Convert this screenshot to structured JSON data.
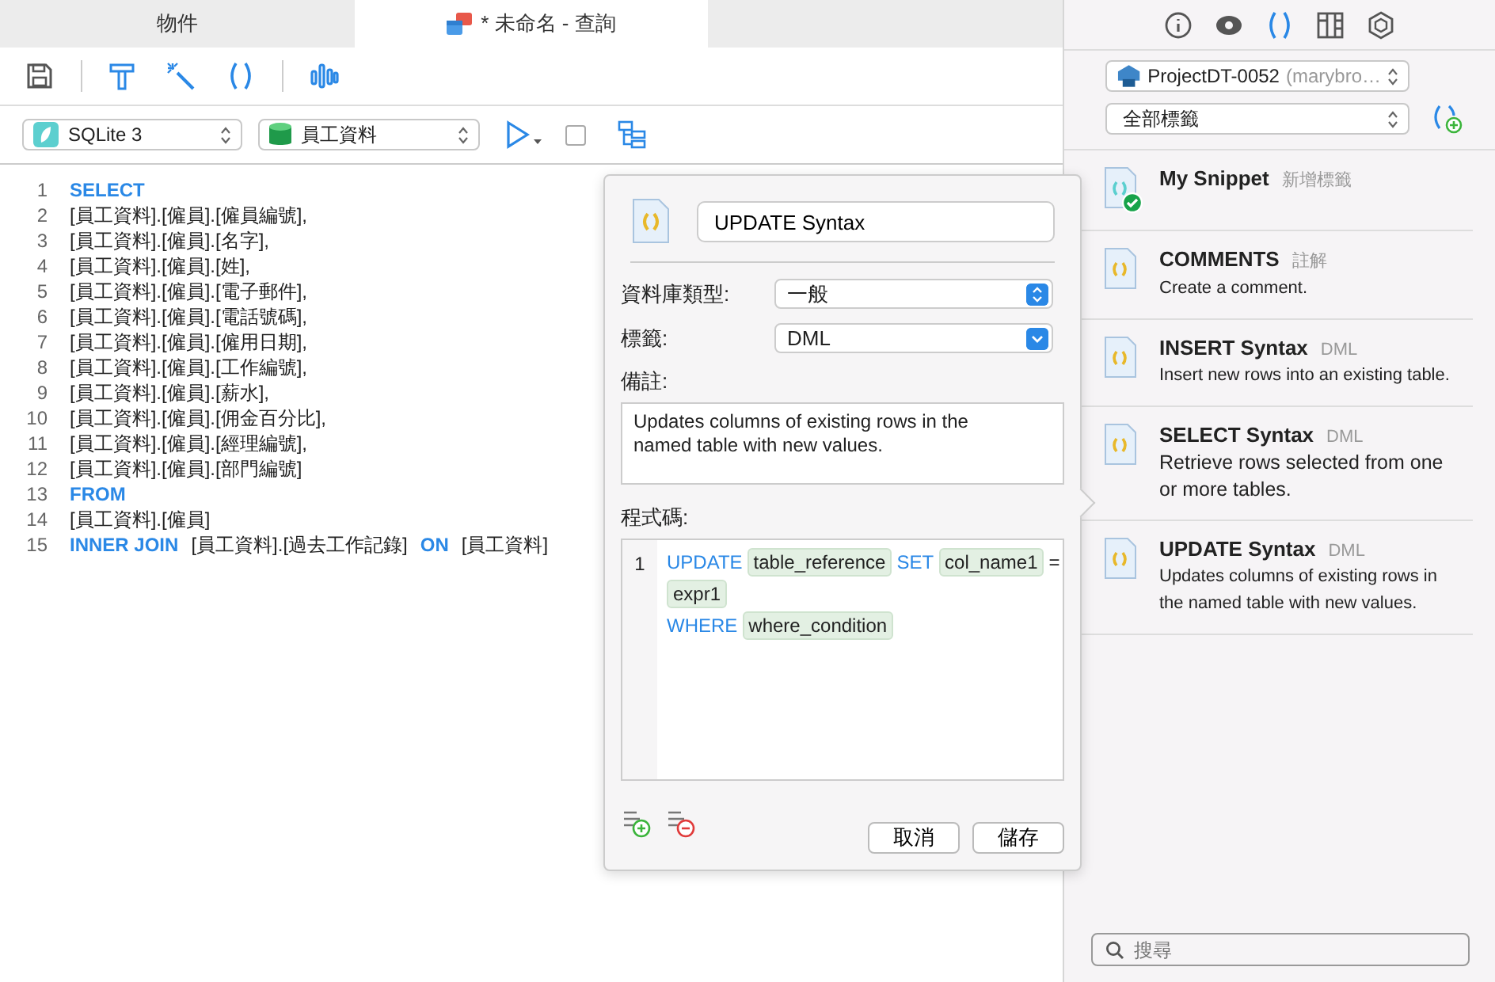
{
  "tabs": [
    {
      "label": "物件",
      "selected": false,
      "kind": "plain"
    },
    {
      "label": "* 未命名 - 查詢",
      "selected": true,
      "kind": "query"
    }
  ],
  "connection": {
    "type": "SQLite 3",
    "database": "員工資料"
  },
  "editor": {
    "lines": [
      {
        "number": "1",
        "tokens": [
          {
            "kind": "keyword",
            "text": "SELECT"
          }
        ]
      },
      {
        "number": "2",
        "tokens": [
          {
            "kind": "text",
            "text": "[員工資料].[僱員].[僱員編號],"
          }
        ]
      },
      {
        "number": "3",
        "tokens": [
          {
            "kind": "text",
            "text": "[員工資料].[僱員].[名字],"
          }
        ]
      },
      {
        "number": "4",
        "tokens": [
          {
            "kind": "text",
            "text": "[員工資料].[僱員].[姓],"
          }
        ]
      },
      {
        "number": "5",
        "tokens": [
          {
            "kind": "text",
            "text": "[員工資料].[僱員].[電子郵件],"
          }
        ]
      },
      {
        "number": "6",
        "tokens": [
          {
            "kind": "text",
            "text": "[員工資料].[僱員].[電話號碼],"
          }
        ]
      },
      {
        "number": "7",
        "tokens": [
          {
            "kind": "text",
            "text": "[員工資料].[僱員].[僱用日期],"
          }
        ]
      },
      {
        "number": "8",
        "tokens": [
          {
            "kind": "text",
            "text": "[員工資料].[僱員].[工作編號],"
          }
        ]
      },
      {
        "number": "9",
        "tokens": [
          {
            "kind": "text",
            "text": "[員工資料].[僱員].[薪水],"
          }
        ]
      },
      {
        "number": "10",
        "tokens": [
          {
            "kind": "text",
            "text": "[員工資料].[僱員].[佣金百分比],"
          }
        ]
      },
      {
        "number": "11",
        "tokens": [
          {
            "kind": "text",
            "text": "[員工資料].[僱員].[經理編號],"
          }
        ]
      },
      {
        "number": "12",
        "tokens": [
          {
            "kind": "text",
            "text": "[員工資料].[僱員].[部門編號]"
          }
        ]
      },
      {
        "number": "13",
        "tokens": [
          {
            "kind": "keyword",
            "text": "FROM"
          }
        ]
      },
      {
        "number": "14",
        "tokens": [
          {
            "kind": "text",
            "text": "[員工資料].[僱員]"
          }
        ]
      },
      {
        "number": "15",
        "tokens": [
          {
            "kind": "keyword",
            "text": "INNER JOIN"
          },
          {
            "kind": "text",
            "text": "[員工資料].[過去工作記錄]"
          },
          {
            "kind": "keyword",
            "text": "ON"
          },
          {
            "kind": "text",
            "text": "[員工資料]"
          }
        ]
      }
    ]
  },
  "popover": {
    "name": "UPDATE Syntax",
    "db_type": {
      "label": "資料庫類型:",
      "value": "一般"
    },
    "tag": {
      "label": "標籤:",
      "value": "DML"
    },
    "note": {
      "label": "備註:",
      "value": "Updates columns of existing rows in the named table with new values."
    },
    "code": {
      "label": "程式碼:",
      "number": "1",
      "rows": [
        [
          {
            "kind": "keyword",
            "text": "UPDATE"
          },
          {
            "kind": "placeholder",
            "text": "table_reference"
          },
          {
            "kind": "keyword",
            "text": "SET"
          },
          {
            "kind": "placeholder",
            "text": "col_name1"
          },
          {
            "kind": "text",
            "text": "="
          },
          {
            "kind": "placeholder",
            "text": "expr1"
          }
        ],
        [
          {
            "kind": "keyword",
            "text": "WHERE"
          },
          {
            "kind": "placeholder",
            "text": "where_condition"
          }
        ]
      ]
    },
    "buttons": [
      "取消",
      "儲存"
    ]
  },
  "side_tabs": [
    {
      "kind": "info",
      "selected": false
    },
    {
      "kind": "preview",
      "selected": false
    },
    {
      "kind": "snippet",
      "selected": true
    },
    {
      "kind": "columns",
      "selected": false
    },
    {
      "kind": "hexagon",
      "selected": false
    }
  ],
  "project": {
    "name": "ProjectDT-0052",
    "owner": "(marybro…"
  },
  "tag_filter": "全部標籤",
  "snippets": [
    {
      "title": "My Snippet",
      "tag": "新增標籤",
      "checked": true
    },
    {
      "title": "COMMENTS",
      "tag": "註解",
      "description": "Create a comment.",
      "checked": false
    },
    {
      "title": "INSERT Syntax",
      "tag": "DML",
      "description": "Insert new rows into an existing table.",
      "checked": false
    },
    {
      "title": "SELECT Syntax",
      "tag": "DML",
      "description": "Retrieve rows selected from one or more tables.",
      "checked": false
    },
    {
      "title": "UPDATE Syntax",
      "tag": "DML",
      "description": "Updates columns of existing rows in the named table with new values.",
      "checked": false
    }
  ],
  "search": {
    "placeholder": "搜尋"
  }
}
